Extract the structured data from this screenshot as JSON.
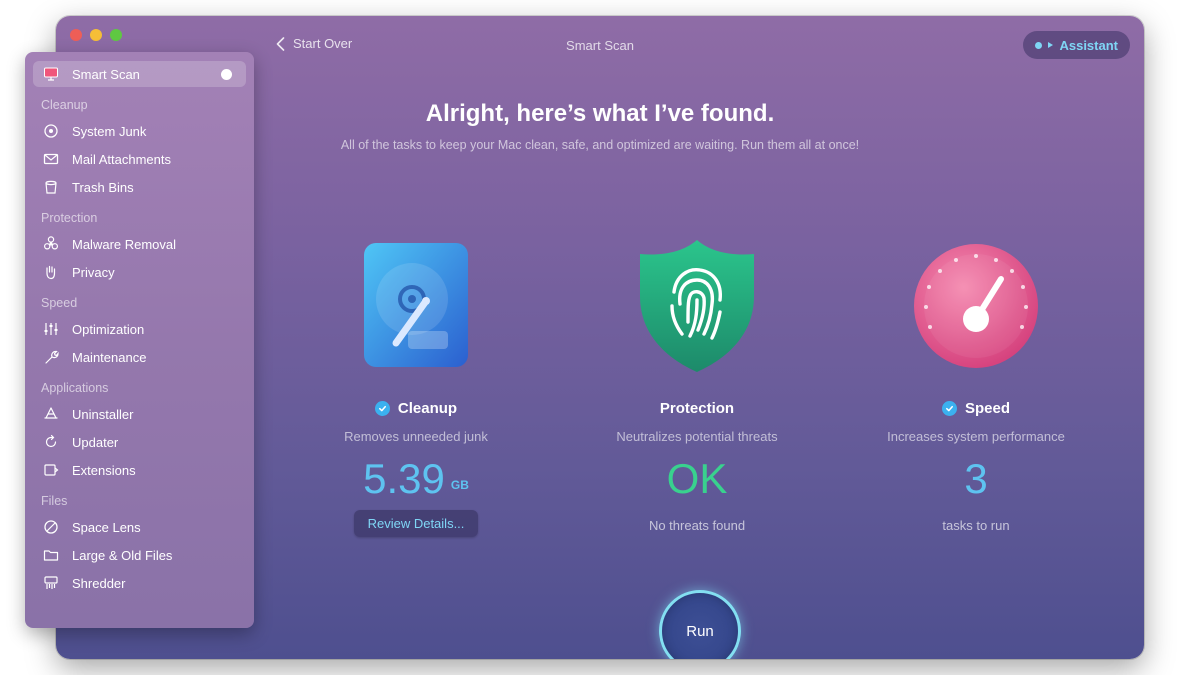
{
  "window": {
    "title": "Smart Scan",
    "back_label": "Start Over",
    "assistant_label": "Assistant"
  },
  "sidebar": {
    "active": {
      "label": "Smart Scan",
      "icon": "monitor-icon"
    },
    "sections": [
      {
        "title": "Cleanup",
        "items": [
          {
            "label": "System Junk",
            "icon": "disk-icon"
          },
          {
            "label": "Mail Attachments",
            "icon": "mail-icon"
          },
          {
            "label": "Trash Bins",
            "icon": "trash-icon"
          }
        ]
      },
      {
        "title": "Protection",
        "items": [
          {
            "label": "Malware Removal",
            "icon": "biohazard-icon"
          },
          {
            "label": "Privacy",
            "icon": "hand-icon"
          }
        ]
      },
      {
        "title": "Speed",
        "items": [
          {
            "label": "Optimization",
            "icon": "sliders-icon"
          },
          {
            "label": "Maintenance",
            "icon": "wrench-icon"
          }
        ]
      },
      {
        "title": "Applications",
        "items": [
          {
            "label": "Uninstaller",
            "icon": "apps-icon"
          },
          {
            "label": "Updater",
            "icon": "update-icon"
          },
          {
            "label": "Extensions",
            "icon": "extensions-icon"
          }
        ]
      },
      {
        "title": "Files",
        "items": [
          {
            "label": "Space Lens",
            "icon": "lens-icon"
          },
          {
            "label": "Large & Old Files",
            "icon": "folder-icon"
          },
          {
            "label": "Shredder",
            "icon": "shredder-icon"
          }
        ]
      }
    ]
  },
  "main": {
    "headline": "Alright, here’s what I’ve found.",
    "subline": "All of the tasks to keep your Mac clean, safe, and optimized are waiting. Run them all at once!",
    "cleanup": {
      "title": "Cleanup",
      "desc": "Removes unneeded junk",
      "value": "5.39",
      "unit": "GB",
      "button": "Review Details..."
    },
    "protection": {
      "title": "Protection",
      "desc": "Neutralizes potential threats",
      "value": "OK",
      "sub": "No threats found"
    },
    "speed": {
      "title": "Speed",
      "desc": "Increases system performance",
      "value": "3",
      "sub": "tasks to run"
    },
    "run_label": "Run"
  },
  "colors": {
    "accent_blue": "#5ec3f0",
    "ok_green": "#39d18e",
    "check_blue": "#3bb1ef"
  }
}
